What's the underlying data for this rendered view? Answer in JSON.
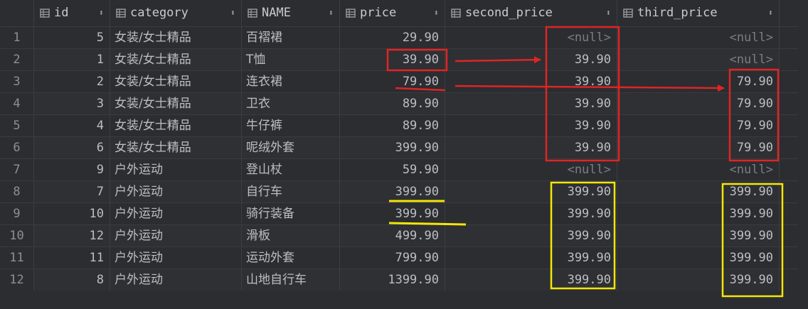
{
  "columns": [
    {
      "key": "id",
      "label": "id"
    },
    {
      "key": "category",
      "label": "category"
    },
    {
      "key": "name",
      "label": "NAME"
    },
    {
      "key": "price",
      "label": "price"
    },
    {
      "key": "second_price",
      "label": "second_price"
    },
    {
      "key": "third_price",
      "label": "third_price"
    }
  ],
  "rows": [
    {
      "n": "1",
      "id": "5",
      "category": "女装/女士精品",
      "name": "百褶裙",
      "price": "29.90",
      "second_price": "<null>",
      "third_price": "<null>"
    },
    {
      "n": "2",
      "id": "1",
      "category": "女装/女士精品",
      "name": "T恤",
      "price": "39.90",
      "second_price": "39.90",
      "third_price": "<null>"
    },
    {
      "n": "3",
      "id": "2",
      "category": "女装/女士精品",
      "name": "连衣裙",
      "price": "79.90",
      "second_price": "39.90",
      "third_price": "79.90"
    },
    {
      "n": "4",
      "id": "3",
      "category": "女装/女士精品",
      "name": "卫衣",
      "price": "89.90",
      "second_price": "39.90",
      "third_price": "79.90"
    },
    {
      "n": "5",
      "id": "4",
      "category": "女装/女士精品",
      "name": "牛仔裤",
      "price": "89.90",
      "second_price": "39.90",
      "third_price": "79.90"
    },
    {
      "n": "6",
      "id": "6",
      "category": "女装/女士精品",
      "name": "呢绒外套",
      "price": "399.90",
      "second_price": "39.90",
      "third_price": "79.90"
    },
    {
      "n": "7",
      "id": "9",
      "category": "户外运动",
      "name": "登山杖",
      "price": "59.90",
      "second_price": "<null>",
      "third_price": "<null>"
    },
    {
      "n": "8",
      "id": "7",
      "category": "户外运动",
      "name": "自行车",
      "price": "399.90",
      "second_price": "399.90",
      "third_price": "399.90"
    },
    {
      "n": "9",
      "id": "10",
      "category": "户外运动",
      "name": "骑行装备",
      "price": "399.90",
      "second_price": "399.90",
      "third_price": "399.90"
    },
    {
      "n": "10",
      "id": "12",
      "category": "户外运动",
      "name": "滑板",
      "price": "499.90",
      "second_price": "399.90",
      "third_price": "399.90"
    },
    {
      "n": "11",
      "id": "11",
      "category": "户外运动",
      "name": "运动外套",
      "price": "799.90",
      "second_price": "399.90",
      "third_price": "399.90"
    },
    {
      "n": "12",
      "id": "8",
      "category": "户外运动",
      "name": "山地自行车",
      "price": "1399.90",
      "second_price": "399.90",
      "third_price": "399.90"
    }
  ],
  "annotations": {
    "red": "#e02424",
    "yellow": "#f5e50a"
  },
  "icons": {
    "column_header": "table-column-icon",
    "sort": "sort-arrows-icon"
  }
}
